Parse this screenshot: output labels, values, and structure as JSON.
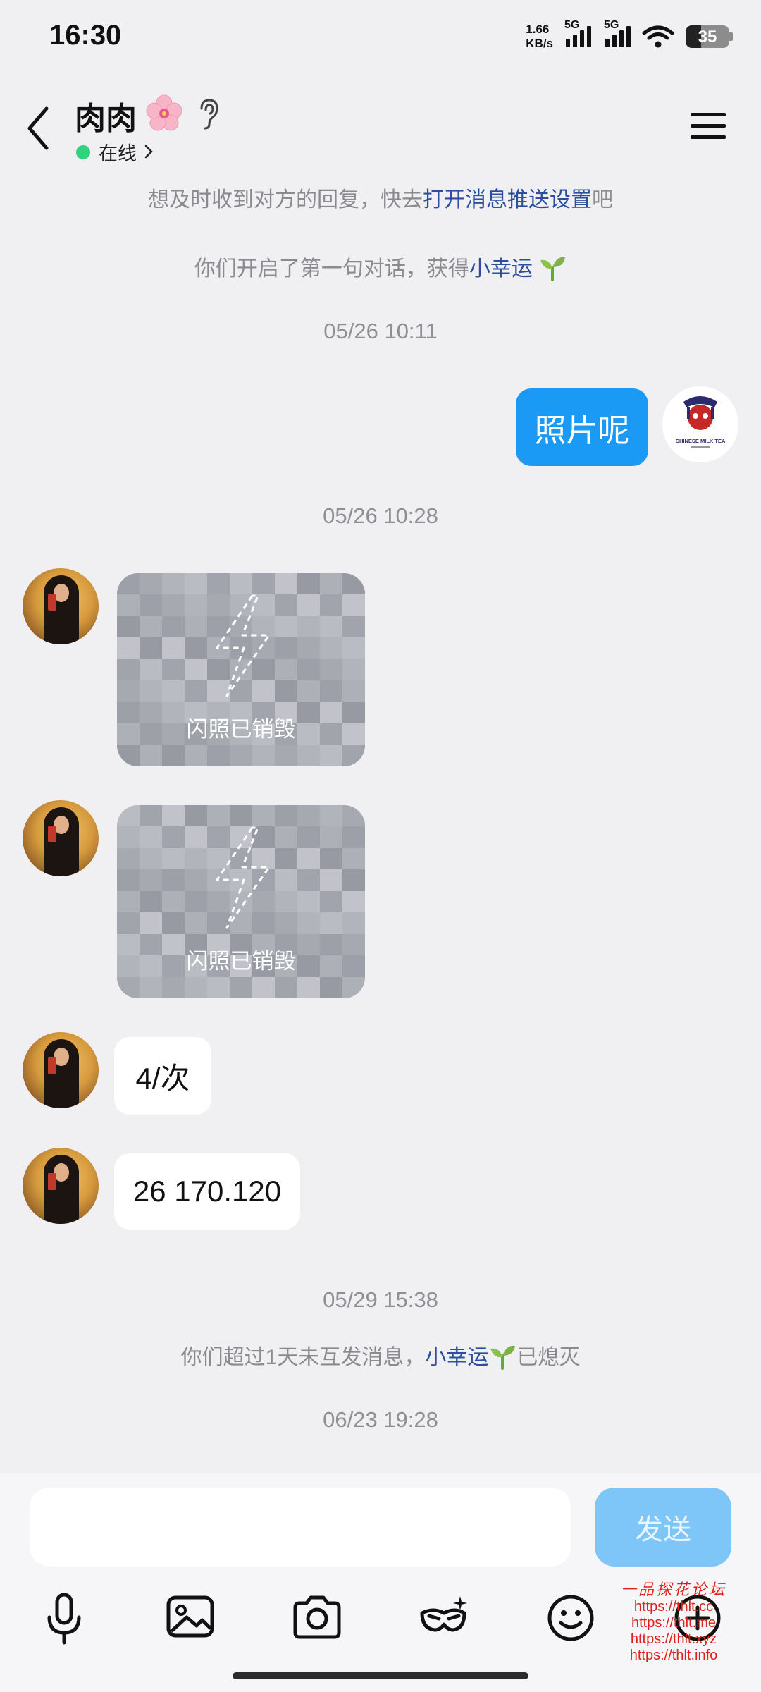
{
  "status_bar": {
    "time": "16:30",
    "net_speed_value": "1.66",
    "net_speed_unit": "KB/s",
    "signal1_label": "5G",
    "signal2_label": "5G",
    "battery": "35"
  },
  "header": {
    "contact_name": "肉肉",
    "presence": "在线"
  },
  "notices": {
    "push_prefix": "想及时收到对方的回复，快去",
    "push_link": "打开消息推送设置",
    "push_suffix": "吧",
    "first_chat_prefix": "你们开启了第一句对话，获得",
    "first_chat_link": "小幸运",
    "expired_prefix": "你们超过1天未互发消息，",
    "expired_link": "小幸运",
    "expired_suffix": "已熄灭"
  },
  "timestamps": [
    "05/26 10:11",
    "05/26 10:28",
    "05/29 15:38",
    "06/23 19:28"
  ],
  "messages": {
    "outgoing_1": "照片呢",
    "flash_label": "闪照已销毁",
    "incoming_text_1": "4/次",
    "incoming_text_2": "26 170.120"
  },
  "self_avatar_text": "CHINESE MILK TEA",
  "input": {
    "placeholder": "",
    "send_label": "发送"
  },
  "toolbar_icons": [
    "microphone-icon",
    "image-icon",
    "camera-icon",
    "mask-icon",
    "emoji-icon",
    "plus-icon"
  ],
  "watermark": {
    "title": "一品探花论坛",
    "urls": [
      "https://thlt.cc",
      "https://thlt.me",
      "https://thlt.xyz",
      "https://thlt.info"
    ]
  },
  "colors": {
    "background": "#f0f0f2",
    "outgoing_bubble": "#1a9af4",
    "link": "#2a4f9e",
    "online": "#2fd27d",
    "send_button": "#7dc6f7",
    "watermark": "#e0201b"
  }
}
